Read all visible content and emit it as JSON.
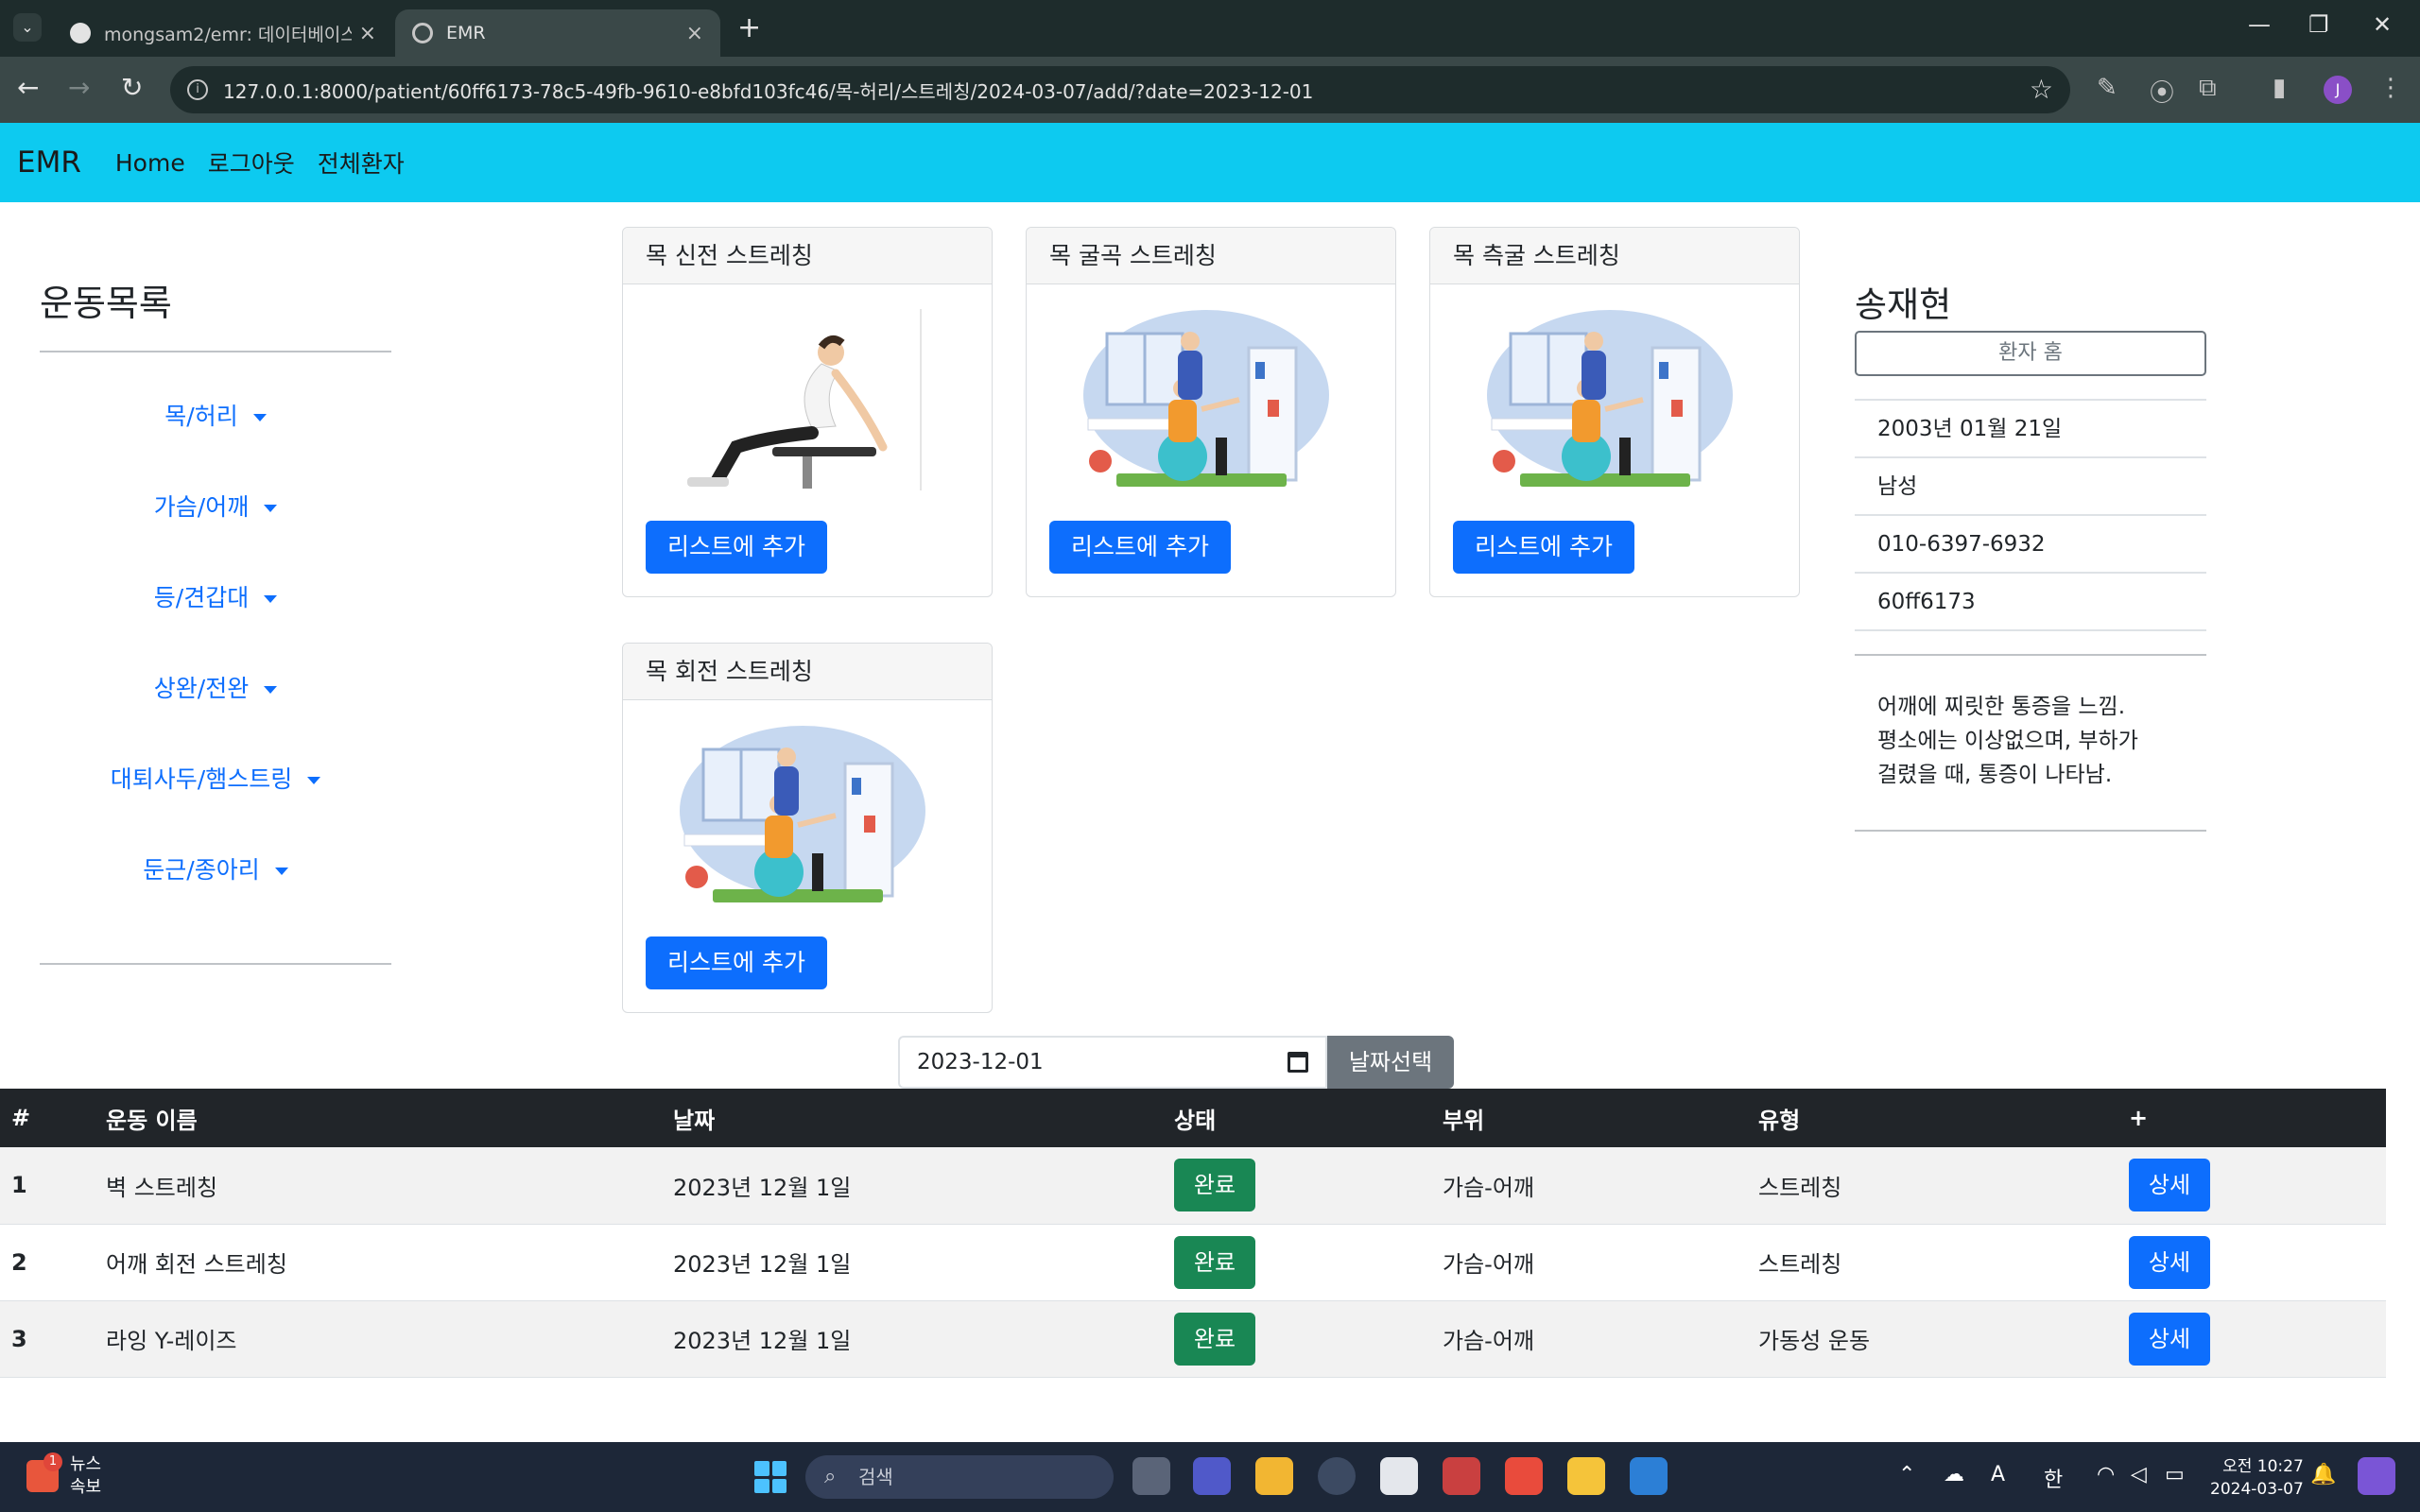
{
  "browser": {
    "tabs": [
      {
        "title": "mongsam2/emr: 데이터베이스",
        "active": false
      },
      {
        "title": "EMR",
        "active": true
      }
    ],
    "url": "127.0.0.1:8000/patient/60ff6173-78c5-49fb-9610-e8bfd103fc46/목-허리/스트레칭/2024-03-07/add/?date=2023-12-01",
    "new_tab": "+",
    "profile_initial": "J"
  },
  "navbar": {
    "brand": "EMR",
    "links": [
      "Home",
      "로그아웃",
      "전체환자"
    ]
  },
  "sidebar": {
    "title": "운동목록",
    "categories": [
      "목/허리",
      "가슴/어깨",
      "등/견갑대",
      "상완/전완",
      "대퇴사두/햄스트링",
      "둔근/종아리"
    ]
  },
  "exercises": [
    {
      "name": "목 신전 스트레칭",
      "image": "stretch-photo",
      "button": "리스트에 추가"
    },
    {
      "name": "목 굴곡 스트레칭",
      "image": "therapy-illustration",
      "button": "리스트에 추가"
    },
    {
      "name": "목 측굴 스트레칭",
      "image": "therapy-illustration",
      "button": "리스트에 추가"
    },
    {
      "name": "목 회전 스트레칭",
      "image": "therapy-illustration",
      "button": "리스트에 추가"
    }
  ],
  "patient": {
    "name": "송재현",
    "home_button": "환자 홈",
    "birth": "2003년 01월 21일",
    "gender": "남성",
    "phone": "010-6397-6932",
    "id": "60ff6173",
    "memo_lines": [
      "어깨에 찌릿한 통증을 느낌.",
      "평소에는 이상없으며, 부하가",
      "걸렸을 때, 통증이 나타남."
    ]
  },
  "date_filter": {
    "value": "2023-12-01",
    "button": "날짜선택"
  },
  "table": {
    "headers": [
      "#",
      "운동 이름",
      "날짜",
      "상태",
      "부위",
      "유형",
      "+"
    ],
    "rows": [
      {
        "num": "1",
        "name": "벽 스트레칭",
        "date": "2023년 12월 1일",
        "status": "완료",
        "part": "가슴-어깨",
        "type": "스트레칭",
        "action": "상세"
      },
      {
        "num": "2",
        "name": "어깨 회전 스트레칭",
        "date": "2023년 12월 1일",
        "status": "완료",
        "part": "가슴-어깨",
        "type": "스트레칭",
        "action": "상세"
      },
      {
        "num": "3",
        "name": "라잉 Y-레이즈",
        "date": "2023년 12월 1일",
        "status": "완료",
        "part": "가슴-어깨",
        "type": "가동성 운동",
        "action": "상세"
      }
    ]
  },
  "taskbar": {
    "news_label": "뉴스",
    "news_sub": "속보",
    "news_badge": "1",
    "search_placeholder": "검색",
    "ime": "한",
    "font_indicator": "A",
    "time": "오전 10:27",
    "date": "2024-03-07"
  },
  "colors": {
    "navbar": "#0dcaf0",
    "primary": "#0d6efd",
    "success": "#198754",
    "secondary": "#6c757d",
    "table_header": "#212529"
  }
}
